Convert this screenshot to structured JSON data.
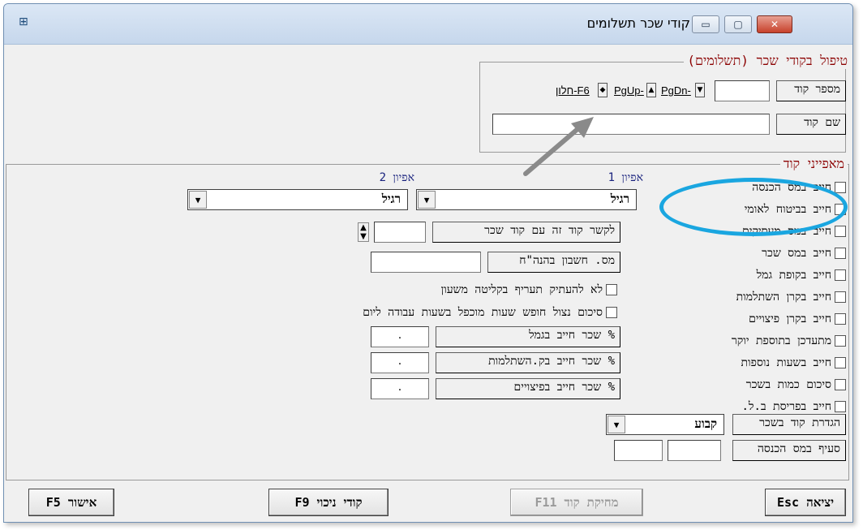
{
  "window": {
    "title": "קודי שכר תשלומים",
    "minimize_glyph": "▭",
    "maximize_glyph": "▢",
    "close_glyph": "✕",
    "app_icon_glyph": "⊞"
  },
  "group_main": {
    "legend": "טיפול בקודי שכר (תשלומים)",
    "code_number_label": "מספר קוד",
    "code_number_value": "",
    "code_name_label": "שם קוד",
    "code_name_value": "",
    "nav_pgdn": "PgDn-",
    "nav_pgup": "PgUp-",
    "nav_window": "חלון-F6"
  },
  "group_features": {
    "legend": "מאפייני קוד",
    "checkboxes": [
      "חייב במס הכנסה",
      "חייב בביטוח לאומי",
      "חייב במס מעסיקים",
      "חייב במס שכר",
      "חייב בקופת גמל",
      "חייב בקרן השתלמות",
      "חייב בקרן פיצויים",
      "מתעדכן בתוספת יוקר",
      "חייב בשעות נוספות",
      "סיכום כמות בשכר",
      "חייב בפריסת ב.ל."
    ],
    "feature1_label": "אפיון 1",
    "feature1_value": "רגיל",
    "feature2_label": "אפיון 2",
    "feature2_value": "רגיל",
    "link_code_label": "לקשר קוד זה עם קוד שכר",
    "link_code_value": "",
    "account_label": "מס. חשבון בהנה\"ח",
    "account_value": "",
    "no_copy_rate_label": "לא להעתיק תעריף בקליטה משעון",
    "sum_vacation_label": "סיכום נצול חופש שעות מוכפל בשעות עבודה ליום",
    "pension_pct_label": "% שכר חייב בגמל",
    "pension_pct_value": ".",
    "training_pct_label": "% שכר חייב בק.השתלמות",
    "training_pct_value": ".",
    "severance_pct_label": "% שכר חייב בפיצויים",
    "severance_pct_value": ".",
    "code_def_label": "הגדרת קוד בשכר",
    "code_def_value": "קבוע",
    "tax_section_label": "סעיף במס הכנסה",
    "tax_section_a": "",
    "tax_section_b": ""
  },
  "buttons": {
    "exit": "יציאה Esc",
    "delete": "מחיקת קוד F11",
    "deduct_codes": "קודי ניכוי F9",
    "confirm": "אישור F5"
  },
  "colors": {
    "legend": "#8b0000",
    "column_header": "#1a237e",
    "highlight": "#1aa6e0"
  }
}
